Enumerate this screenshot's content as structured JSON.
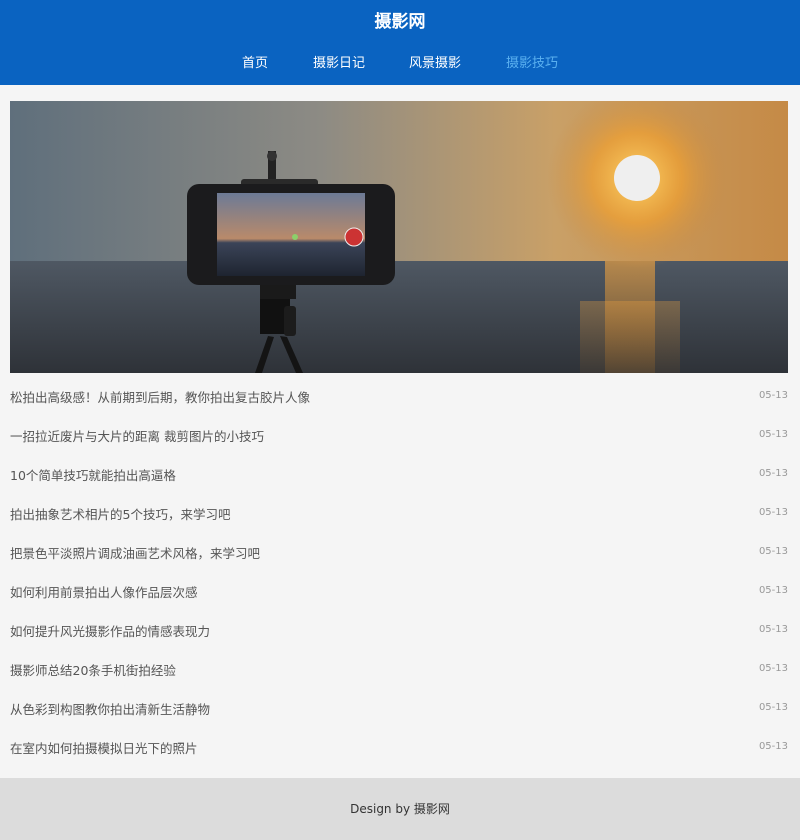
{
  "header": {
    "site_title": "摄影网",
    "nav": [
      {
        "label": "首页",
        "active": false
      },
      {
        "label": "摄影日记",
        "active": false
      },
      {
        "label": "风景摄影",
        "active": false
      },
      {
        "label": "摄影技巧",
        "active": true
      }
    ]
  },
  "articles": [
    {
      "title": "松拍出高级感！从前期到后期，教你拍出复古胶片人像",
      "date": "05-13"
    },
    {
      "title": "一招拉近废片与大片的距离 裁剪图片的小技巧",
      "date": "05-13"
    },
    {
      "title": "10个简单技巧就能拍出高逼格",
      "date": "05-13"
    },
    {
      "title": "拍出抽象艺术相片的5个技巧，来学习吧",
      "date": "05-13"
    },
    {
      "title": "把景色平淡照片调成油画艺术风格，来学习吧",
      "date": "05-13"
    },
    {
      "title": "如何利用前景拍出人像作品层次感",
      "date": "05-13"
    },
    {
      "title": "如何提升风光摄影作品的情感表现力",
      "date": "05-13"
    },
    {
      "title": "摄影师总结20条手机街拍经验",
      "date": "05-13"
    },
    {
      "title": "从色彩到构图教你拍出清新生活静物",
      "date": "05-13"
    },
    {
      "title": "在室内如何拍摄模拟日光下的照片",
      "date": "05-13"
    }
  ],
  "footer": {
    "text": "Design by 摄影网"
  },
  "colors": {
    "header_bg": "#0a63c1",
    "nav_active": "#5ab0f0",
    "footer_bg": "#dcdcdc"
  }
}
